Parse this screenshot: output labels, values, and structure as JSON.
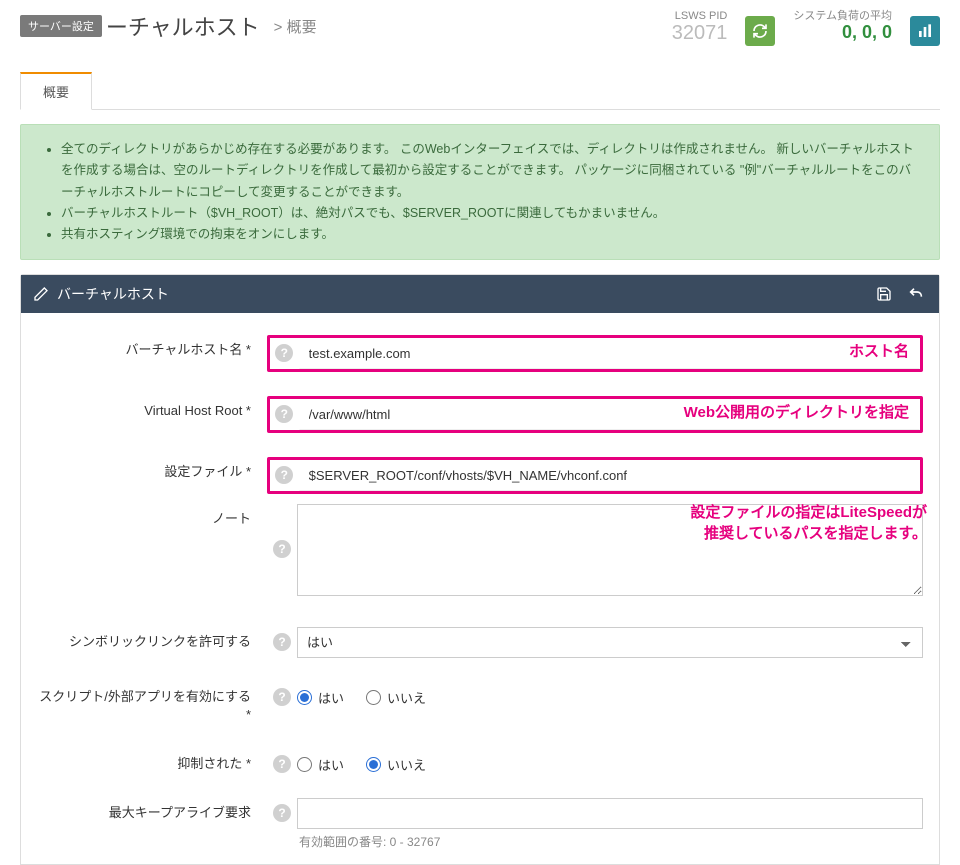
{
  "header": {
    "server_tag": "サーバー設定",
    "title_main": "ーチャルホスト",
    "title_sub": "> 概要",
    "pid_label": "LSWS PID",
    "pid_value": "32071",
    "load_label": "システム負荷の平均",
    "load_value": "0, 0, 0"
  },
  "tabs": {
    "summary": "概要"
  },
  "alert": {
    "items": [
      "全てのディレクトリがあらかじめ存在する必要があります。 このWebインターフェイスでは、ディレクトリは作成されません。 新しいバーチャルホストを作成する場合は、空のルートディレクトリを作成して最初から設定することができます。 パッケージに同梱されている \"例\"バーチャルルートをこのバーチャルホストルートにコピーして変更することができます。",
      "バーチャルホストルート（$VH_ROOT）は、絶対パスでも、$SERVER_ROOTに関連してもかまいません。",
      "共有ホスティング環境での拘束をオンにします。"
    ]
  },
  "panel": {
    "title": "バーチャルホスト"
  },
  "form": {
    "vhost_name": {
      "label": "バーチャルホスト名 *",
      "value": "test.example.com",
      "annotation": "ホスト名"
    },
    "vhost_root": {
      "label": "Virtual Host Root *",
      "value": "/var/www/html",
      "annotation": "Web公開用のディレクトリを指定"
    },
    "config_file": {
      "label": "設定ファイル *",
      "value": "$SERVER_ROOT/conf/vhosts/$VH_NAME/vhconf.conf"
    },
    "config_annotation_l1": "設定ファイルの指定はLiteSpeedが",
    "config_annotation_l2": "推奨しているパスを指定します。",
    "note": {
      "label": "ノート",
      "value": ""
    },
    "follow_symlink": {
      "label": "シンボリックリンクを許可する",
      "selected": "はい"
    },
    "enable_script": {
      "label": "スクリプト/外部アプリを有効にする *",
      "opt_yes": "はい",
      "opt_no": "いいえ",
      "value": "yes"
    },
    "restrained": {
      "label": "抑制された *",
      "opt_yes": "はい",
      "opt_no": "いいえ",
      "value": "no"
    },
    "max_keepalive": {
      "label": "最大キープアライブ要求",
      "value": ""
    },
    "range_hint": "有効範囲の番号: 0 - 32767"
  }
}
